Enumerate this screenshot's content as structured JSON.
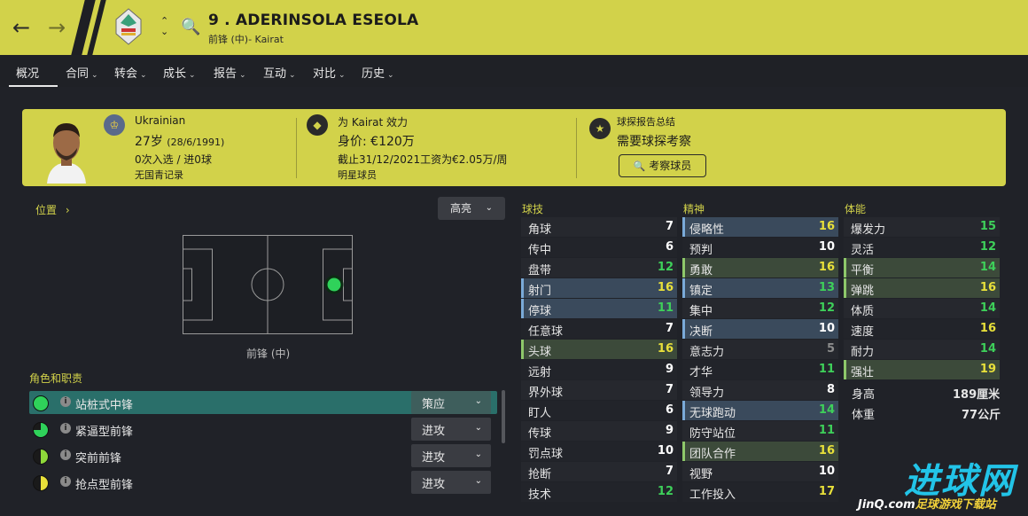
{
  "header": {
    "player_title": "9 . ADERINSOLA ESEOLA",
    "player_subtitle": "前锋 (中)- Kairat",
    "icons": {
      "back": "arrow-left-icon",
      "forward": "arrow-right-icon",
      "search": "search-icon"
    }
  },
  "tabs": [
    {
      "label": "概况",
      "dropdown": false
    },
    {
      "label": "合同",
      "dropdown": true
    },
    {
      "label": "转会",
      "dropdown": true
    },
    {
      "label": "成长",
      "dropdown": true
    },
    {
      "label": "报告",
      "dropdown": true
    },
    {
      "label": "互动",
      "dropdown": true
    },
    {
      "label": "对比",
      "dropdown": true
    },
    {
      "label": "历史",
      "dropdown": true
    }
  ],
  "card": {
    "nationality": "Ukrainian",
    "age_label": "27岁",
    "birth": "(28/6/1991)",
    "caps": "0次入选 / 进0球",
    "youth": "无国青记录",
    "club_line": "为 Kairat 效力",
    "value_label": "身价: €120万",
    "contract": "截止31/12/2021工资为€2.05万/周",
    "status": "明星球员",
    "scout_title": "球探报告总结",
    "scout_value": "需要球探考察",
    "scout_button": "考察球员"
  },
  "position_panel": {
    "link": "位置",
    "highlight_btn": "高亮",
    "position_label": "前锋 (中)"
  },
  "roles": {
    "header": "角色和职责",
    "items": [
      {
        "name": "站桩式中锋",
        "duty": "策应",
        "suitability": "full",
        "selected": true
      },
      {
        "name": "紧逼型前锋",
        "duty": "进攻",
        "suitability": "three-quarter",
        "selected": false
      },
      {
        "name": "突前前锋",
        "duty": "进攻",
        "suitability": "half",
        "selected": false
      },
      {
        "name": "抢点型前锋",
        "duty": "进攻",
        "suitability": "half-yellow",
        "selected": false
      }
    ]
  },
  "attributes": {
    "technical": {
      "title": "球技",
      "items": [
        {
          "name": "角球",
          "value": 7,
          "hl": ""
        },
        {
          "name": "传中",
          "value": 6,
          "hl": ""
        },
        {
          "name": "盘带",
          "value": 12,
          "hl": ""
        },
        {
          "name": "射门",
          "value": 16,
          "hl": "blue"
        },
        {
          "name": "停球",
          "value": 11,
          "hl": "blue"
        },
        {
          "name": "任意球",
          "value": 7,
          "hl": ""
        },
        {
          "name": "头球",
          "value": 16,
          "hl": "green"
        },
        {
          "name": "远射",
          "value": 9,
          "hl": ""
        },
        {
          "name": "界外球",
          "value": 7,
          "hl": ""
        },
        {
          "name": "盯人",
          "value": 6,
          "hl": ""
        },
        {
          "name": "传球",
          "value": 9,
          "hl": ""
        },
        {
          "name": "罚点球",
          "value": 10,
          "hl": ""
        },
        {
          "name": "抢断",
          "value": 7,
          "hl": ""
        },
        {
          "name": "技术",
          "value": 12,
          "hl": ""
        }
      ]
    },
    "mental": {
      "title": "精神",
      "items": [
        {
          "name": "侵略性",
          "value": 16,
          "hl": "blue"
        },
        {
          "name": "预判",
          "value": 10,
          "hl": ""
        },
        {
          "name": "勇敢",
          "value": 16,
          "hl": "green"
        },
        {
          "name": "镇定",
          "value": 13,
          "hl": "blue"
        },
        {
          "name": "集中",
          "value": 12,
          "hl": ""
        },
        {
          "name": "决断",
          "value": 10,
          "hl": "blue"
        },
        {
          "name": "意志力",
          "value": 5,
          "hl": ""
        },
        {
          "name": "才华",
          "value": 11,
          "hl": ""
        },
        {
          "name": "领导力",
          "value": 8,
          "hl": ""
        },
        {
          "name": "无球跑动",
          "value": 14,
          "hl": "blue"
        },
        {
          "name": "防守站位",
          "value": 11,
          "hl": ""
        },
        {
          "name": "团队合作",
          "value": 16,
          "hl": "green"
        },
        {
          "name": "视野",
          "value": 10,
          "hl": ""
        },
        {
          "name": "工作投入",
          "value": 17,
          "hl": ""
        }
      ]
    },
    "physical": {
      "title": "体能",
      "items": [
        {
          "name": "爆发力",
          "value": 15,
          "hl": ""
        },
        {
          "name": "灵活",
          "value": 12,
          "hl": ""
        },
        {
          "name": "平衡",
          "value": 14,
          "hl": "green"
        },
        {
          "name": "弹跳",
          "value": 16,
          "hl": "green"
        },
        {
          "name": "体质",
          "value": 14,
          "hl": ""
        },
        {
          "name": "速度",
          "value": 16,
          "hl": ""
        },
        {
          "name": "耐力",
          "value": 14,
          "hl": ""
        },
        {
          "name": "强壮",
          "value": 19,
          "hl": "green"
        }
      ],
      "height_label": "身高",
      "height": "189厘米",
      "weight_label": "体重",
      "weight": "77公斤"
    }
  },
  "watermark": {
    "logo": "进球网",
    "site": "JinQ.com",
    "tagline": "足球游戏下载站"
  },
  "colors": {
    "accent": "#d2d24a",
    "bg": "#202228",
    "value_white": "#ffffff",
    "value_yellow": "#e8e03a",
    "value_green": "#3ed05a",
    "value_gray": "#8c8c8c",
    "hl_blue": "#3a4a5c",
    "hl_green": "#3c4a3a"
  }
}
